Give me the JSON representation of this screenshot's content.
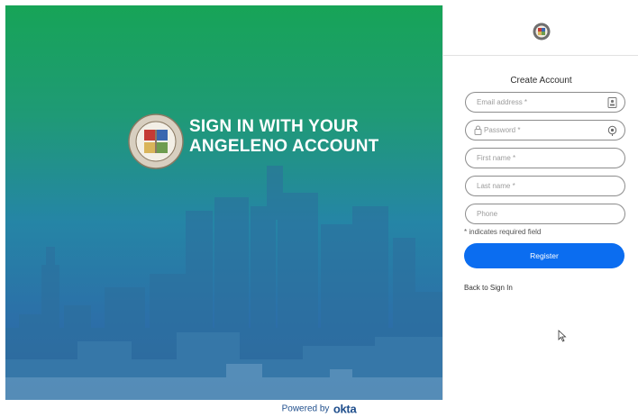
{
  "hero": {
    "title_line1": "SIGN IN WITH YOUR",
    "title_line2": "ANGELENO ACCOUNT"
  },
  "form": {
    "title": "Create Account",
    "fields": [
      {
        "placeholder": "Email address *",
        "icon": "contact-card-icon"
      },
      {
        "placeholder": "Password *",
        "icon": "lock-icon",
        "trailing_icon": "eye-icon"
      },
      {
        "placeholder": "First name *"
      },
      {
        "placeholder": "Last name *"
      },
      {
        "placeholder": "Phone"
      }
    ],
    "required_note": "* indicates required field",
    "register_label": "Register",
    "back_link": "Back to Sign In"
  },
  "footer": {
    "powered_by": "Powered by",
    "brand": "okta"
  },
  "colors": {
    "hero_top": "#17a457",
    "hero_bottom": "#2f64a0",
    "button": "#0b6df0",
    "footer_text": "#1f4e8c"
  }
}
